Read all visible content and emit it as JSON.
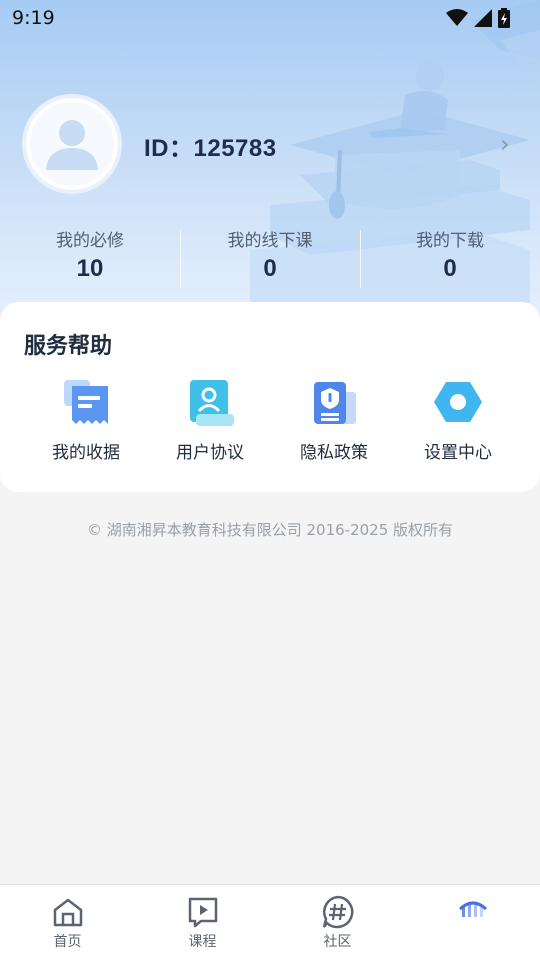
{
  "status_bar": {
    "time": "9:19",
    "icons": [
      "wifi-icon",
      "signal-icon",
      "battery-charging-icon"
    ]
  },
  "profile": {
    "avatar_icon": "user-avatar-icon",
    "id_text": "ID：125783",
    "chevron_icon": "chevron-right-icon"
  },
  "stats": [
    {
      "label": "我的必修",
      "value": "10"
    },
    {
      "label": "我的线下课",
      "value": "0"
    },
    {
      "label": "我的下载",
      "value": "0"
    }
  ],
  "service": {
    "title": "服务帮助",
    "items": [
      {
        "label": "我的收据",
        "icon": "receipt-icon"
      },
      {
        "label": "用户协议",
        "icon": "user-agreement-icon"
      },
      {
        "label": "隐私政策",
        "icon": "privacy-shield-icon"
      },
      {
        "label": "设置中心",
        "icon": "settings-hex-icon"
      }
    ]
  },
  "copyright": "© 湖南湘昇本教育科技有限公司 2016-2025 版权所有",
  "bottom_nav": [
    {
      "label": "首页",
      "icon": "home-icon"
    },
    {
      "label": "课程",
      "icon": "course-play-icon"
    },
    {
      "label": "社区",
      "icon": "community-hash-icon"
    },
    {
      "label": "",
      "icon": "profile-active-icon"
    }
  ],
  "colors": {
    "header_top": "#a6cbf4",
    "header_bottom": "#e6f0fc",
    "accent_blue": "#4a8ef0",
    "text_dark": "#1f2d4b",
    "page_bg": "#f4f4f4"
  }
}
